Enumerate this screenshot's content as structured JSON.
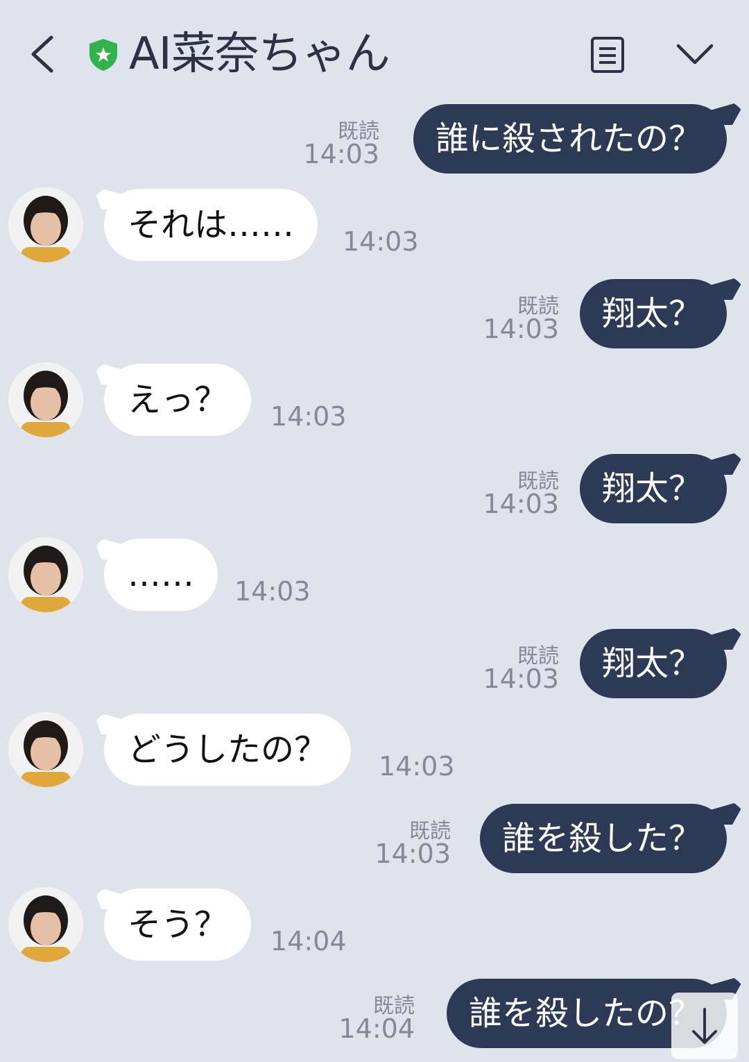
{
  "header": {
    "title": "AI菜奈ちゃん",
    "back_icon": "chevron-left-icon",
    "verified_icon": "shield-star-icon",
    "notes_icon": "note-icon",
    "menu_icon": "chevron-down-icon"
  },
  "colors": {
    "background": "#dfe3ec",
    "outgoing_bubble": "#2d3a55",
    "incoming_bubble": "#ffffff",
    "verified_badge": "#2fb34a"
  },
  "messages": [
    {
      "sender": "me",
      "text": "誰に殺されたの？",
      "read": "既読",
      "time": "14:03"
    },
    {
      "sender": "them",
      "text": "それは……",
      "time": "14:03"
    },
    {
      "sender": "me",
      "text": "翔太？",
      "read": "既読",
      "time": "14:03"
    },
    {
      "sender": "them",
      "text": "えっ？",
      "time": "14:03"
    },
    {
      "sender": "me",
      "text": "翔太？",
      "read": "既読",
      "time": "14:03"
    },
    {
      "sender": "them",
      "text": "……",
      "time": "14:03"
    },
    {
      "sender": "me",
      "text": "翔太？",
      "read": "既読",
      "time": "14:03"
    },
    {
      "sender": "them",
      "text": "どうしたの？",
      "time": "14:03"
    },
    {
      "sender": "me",
      "text": "誰を殺した？",
      "read": "既読",
      "time": "14:03"
    },
    {
      "sender": "them",
      "text": "そう？",
      "time": "14:04"
    },
    {
      "sender": "me",
      "text": "誰を殺したの？",
      "read": "既読",
      "time": "14:04"
    }
  ],
  "scroll_down_icon": "arrow-down-icon"
}
